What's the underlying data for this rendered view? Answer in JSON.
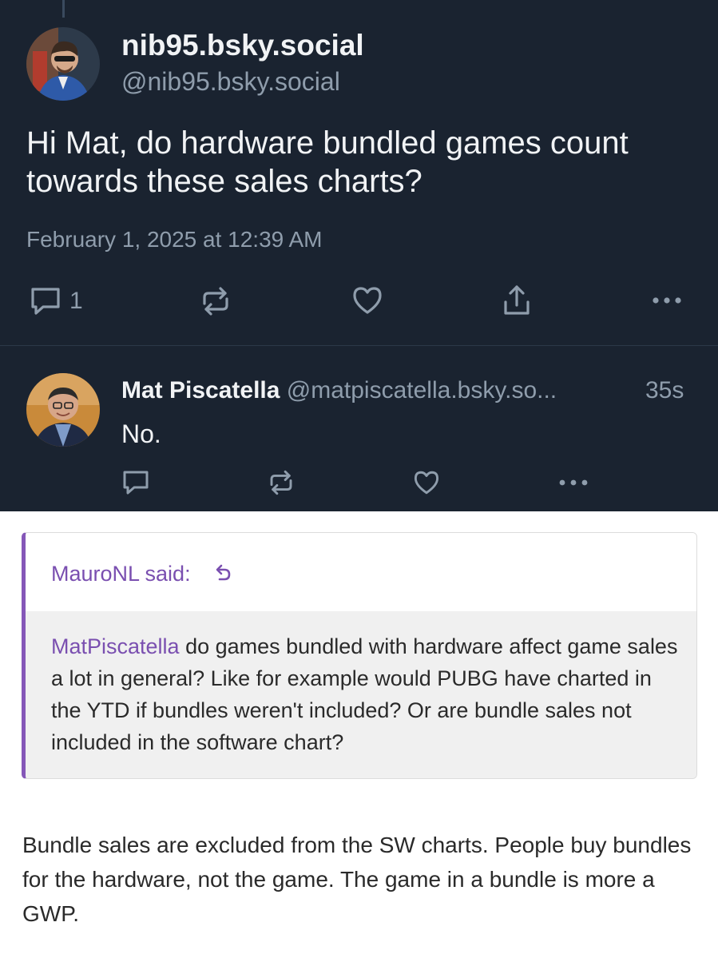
{
  "post": {
    "display_name": "nib95.bsky.social",
    "handle": "@nib95.bsky.social",
    "text": "Hi Mat, do hardware bundled games count towards these sales charts?",
    "timestamp": "February 1, 2025 at 12:39 AM",
    "reply_count": "1",
    "icons": [
      "reply-icon",
      "repost-icon",
      "like-icon",
      "share-icon",
      "more-icon"
    ]
  },
  "reply": {
    "display_name": "Mat Piscatella",
    "handle": "@matpiscatella.bsky.so...",
    "time_ago": "35s",
    "text": "No.",
    "icons": [
      "reply-icon",
      "repost-icon",
      "like-icon",
      "more-icon"
    ]
  },
  "forum": {
    "quote": {
      "author_label": "MauroNL said:",
      "mention": "MatPiscatella",
      "text": " do games bundled with hardware affect game sales a lot in general? Like for example would PUBG have charted in the YTD if bundles weren't included? Or are bundle sales not included in the software chart?"
    },
    "answer": "Bundle sales are excluded from the SW charts. People buy bundles for the hardware, not the game. The game in a bundle is more a GWP."
  },
  "colors": {
    "dark_bg": "#1a2330",
    "text_primary": "#f1f3f5",
    "text_muted": "#8f9dac",
    "forum_accent": "#7a4fb0",
    "quote_border": "#8557b8",
    "quote_bg": "#f0f0f0"
  }
}
